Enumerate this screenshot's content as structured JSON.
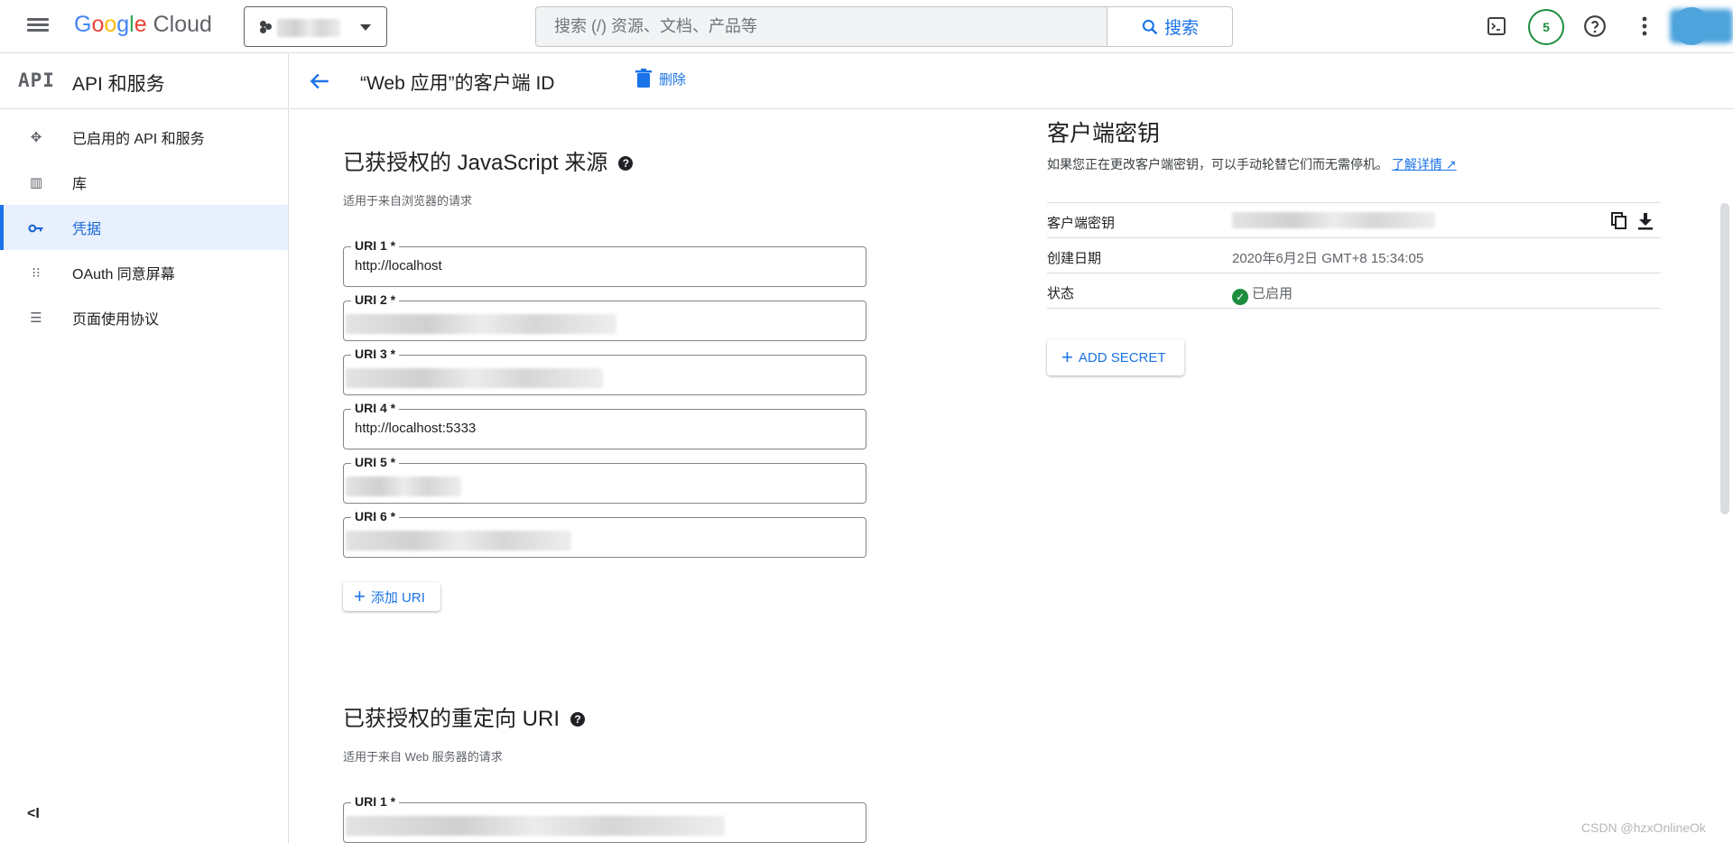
{
  "app": {
    "logo_text": "Google Cloud",
    "search_placeholder": "搜索 (/) 资源、文档、产品等",
    "search_button": "搜索",
    "notification_count": "5"
  },
  "sidebar": {
    "api_badge": "API",
    "title": "API 和服务",
    "items": [
      {
        "label": "已启用的 API 和服务",
        "icon": "diamond-arrows-icon"
      },
      {
        "label": "库",
        "icon": "library-icon"
      },
      {
        "label": "凭据",
        "icon": "key-icon",
        "active": true
      },
      {
        "label": "OAuth 同意屏幕",
        "icon": "oauth-icon"
      },
      {
        "label": "页面使用协议",
        "icon": "settings-list-icon"
      }
    ],
    "collapse_label": "<I"
  },
  "header": {
    "title": "“Web 应用”的客户端 ID",
    "delete_label": "删除"
  },
  "js_origins": {
    "title": "已获授权的 JavaScript 来源",
    "subtitle": "适用于来自浏览器的请求",
    "uris": [
      {
        "label": "URI 1 *",
        "value": "http://localhost"
      },
      {
        "label": "URI 2 *",
        "value": ""
      },
      {
        "label": "URI 3 *",
        "value": ""
      },
      {
        "label": "URI 4 *",
        "value": "http://localhost:5333"
      },
      {
        "label": "URI 5 *",
        "value": ""
      },
      {
        "label": "URI 6 *",
        "value": ""
      }
    ],
    "add_uri_label": "添加 URI"
  },
  "redirect_uris": {
    "title": "已获授权的重定向 URI",
    "subtitle": "适用于来自 Web 服务器的请求",
    "uris": [
      {
        "label": "URI 1 *",
        "value": ""
      }
    ]
  },
  "client_secret": {
    "title": "客户端密钥",
    "description": "如果您正在更改客户端密钥，可以手动轮替它们而无需停机。",
    "learn_more": "了解详情",
    "rows": {
      "secret_key": "客户端密钥",
      "created_key": "创建日期",
      "created_value": "2020年6月2日 GMT+8 15:34:05",
      "status_key": "状态",
      "status_value": "已启用"
    },
    "add_secret_label": "ADD SECRET"
  },
  "watermark": "CSDN @hzxOnlineOk",
  "colors": {
    "accent": "#1a73e8",
    "active_bg": "#e8f0fe",
    "success": "#1e8e3e"
  }
}
